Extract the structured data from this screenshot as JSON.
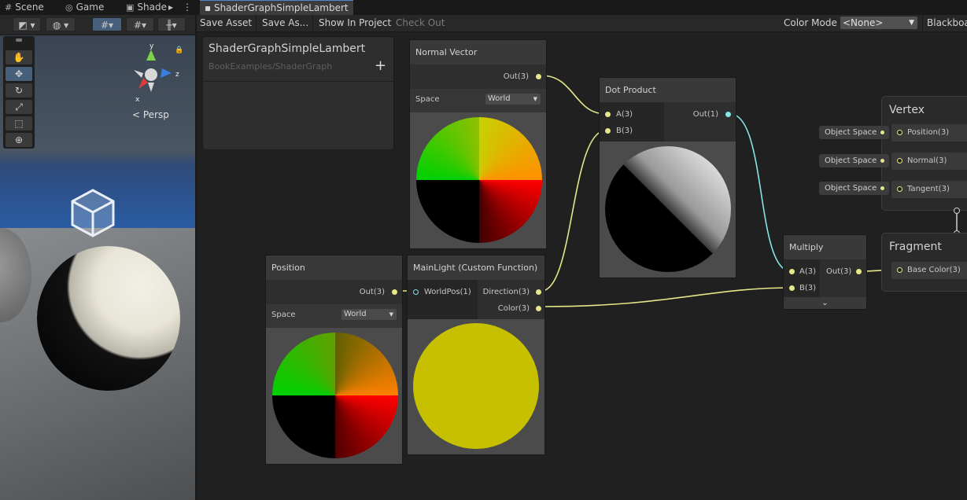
{
  "scene_panel": {
    "tabs": [
      {
        "label": "Scene",
        "icon": "hash-icon"
      },
      {
        "label": "Game",
        "icon": "gamepad-icon"
      },
      {
        "label": "Shade",
        "icon": "shader-icon"
      }
    ],
    "tab_more": "▸",
    "tab_menu": "⋮",
    "persp_label": "< Persp"
  },
  "shader_editor": {
    "tab_title": "ShaderGraphSimpleLambert",
    "toolbar": {
      "save_asset": "Save Asset",
      "save_as": "Save As...",
      "show_in_project": "Show In Project",
      "check_out": "Check Out",
      "color_mode_label": "Color Mode",
      "color_mode_value": "<None>",
      "blackboard": "Blackboa"
    },
    "blackboard_panel": {
      "title": "ShaderGraphSimpleLambert",
      "subtitle": "BookExamples/ShaderGraph",
      "add": "+"
    },
    "nodes": {
      "normal_vector": {
        "title": "Normal Vector",
        "out": "Out(3)",
        "space_label": "Space",
        "space_value": "World"
      },
      "position": {
        "title": "Position",
        "out": "Out(3)",
        "space_label": "Space",
        "space_value": "World"
      },
      "dot_product": {
        "title": "Dot Product",
        "in_a": "A(3)",
        "in_b": "B(3)",
        "out": "Out(1)"
      },
      "main_light": {
        "title": "MainLight (Custom Function)",
        "in_worldpos": "WorldPos(1)",
        "out_direction": "Direction(3)",
        "out_color": "Color(3)"
      },
      "multiply": {
        "title": "Multiply",
        "in_a": "A(3)",
        "in_b": "B(3)",
        "out": "Out(3)"
      }
    },
    "vertex": {
      "title": "Vertex",
      "slots": [
        {
          "input": "Object Space",
          "label": "Position(3)"
        },
        {
          "input": "Object Space",
          "label": "Normal(3)"
        },
        {
          "input": "Object Space",
          "label": "Tangent(3)"
        }
      ]
    },
    "fragment": {
      "title": "Fragment",
      "slots": [
        {
          "label": "Base Color(3)"
        }
      ]
    }
  },
  "colors": {
    "port_vec3": "#e6e68a",
    "port_float": "#84e4e7",
    "accent": "#46607c",
    "light_color": "#c6c000"
  }
}
